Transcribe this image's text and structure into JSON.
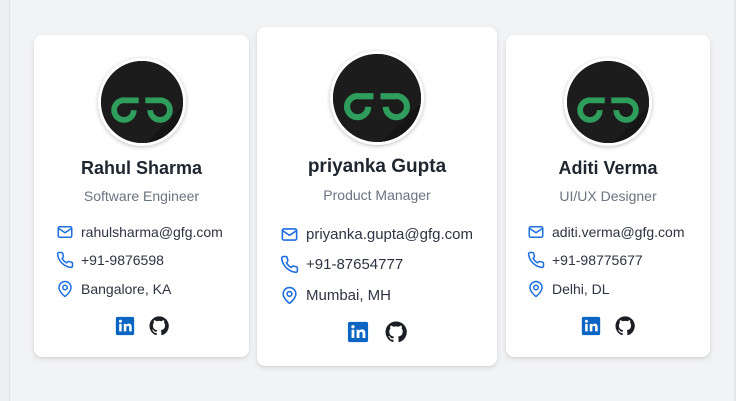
{
  "colors": {
    "accent": "#1d6fe0",
    "linkedin": "#0a66c2",
    "logo_green": "#2f9d5c",
    "avatar_bg": "#1c1c1c"
  },
  "cards": [
    {
      "name": "Rahul Sharma",
      "role": "Software Engineer",
      "email": "rahulsharma@gfg.com",
      "phone": "+91-9876598",
      "location": "Bangalore, KA"
    },
    {
      "name": "priyanka Gupta",
      "role": "Product Manager",
      "email": "priyanka.gupta@gfg.com",
      "phone": "+91-87654777",
      "location": "Mumbai, MH"
    },
    {
      "name": "Aditi Verma",
      "role": "UI/UX Designer",
      "email": "aditi.verma@gfg.com",
      "phone": "+91-98775677",
      "location": "Delhi, DL"
    }
  ],
  "icons": {
    "email": "mail-icon",
    "phone": "phone-icon",
    "location": "map-pin-icon",
    "linkedin": "linkedin-icon",
    "github": "github-icon",
    "avatar_logo": "gfg-logo-icon"
  }
}
